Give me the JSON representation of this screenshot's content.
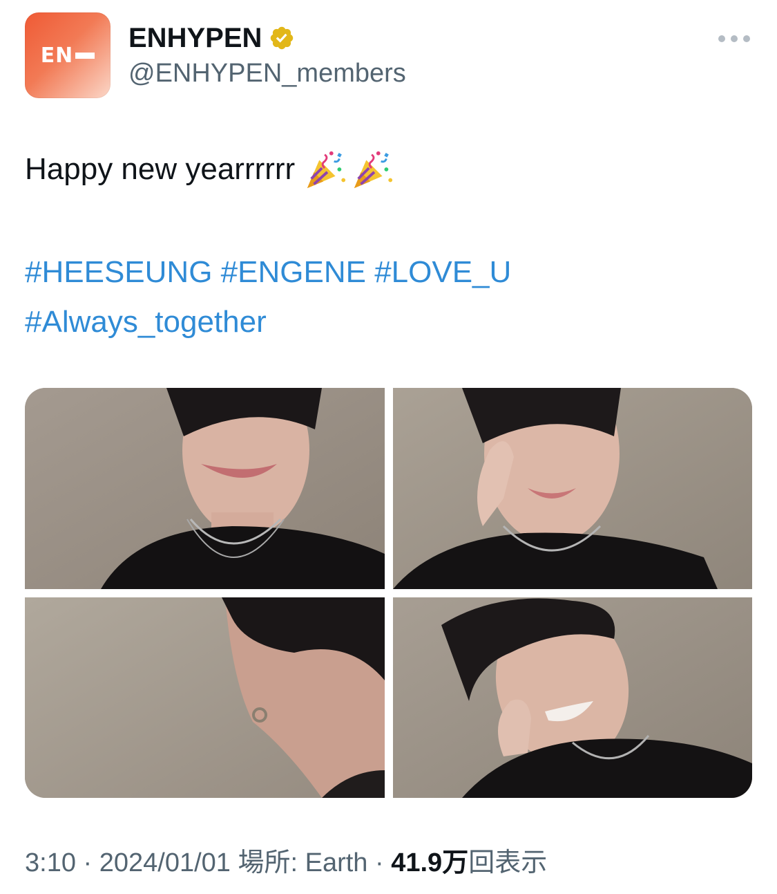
{
  "account": {
    "display_name": "ENHYPEN",
    "handle": "@ENHYPEN_members",
    "avatar_text": "EN",
    "verified_icon": "gold-verified-badge-icon"
  },
  "more_menu_icon": "more-options-icon",
  "tweet": {
    "text": "Happy new yearrrrrr",
    "emojis": [
      "party-popper-icon",
      "party-popper-icon"
    ],
    "hashtags": [
      "#HEESEUNG",
      "#ENGENE",
      "#LOVE_U",
      "#Always_together"
    ]
  },
  "media": [
    {
      "name": "photo-1",
      "description_icon": "selfie-photo"
    },
    {
      "name": "photo-2",
      "description_icon": "selfie-photo"
    },
    {
      "name": "photo-3",
      "description_icon": "selfie-photo"
    },
    {
      "name": "photo-4",
      "description_icon": "selfie-photo"
    }
  ],
  "footer": {
    "time": "3:10",
    "separator": "·",
    "date": "2024/01/01",
    "location": "場所: Earth",
    "views_count": "41.9万",
    "views_label": "回表示"
  },
  "colors": {
    "link": "#2f8bd6",
    "secondary_text": "#536471",
    "brand_gradient_start": "#ef5a35",
    "verified_gold": "#e2b719"
  }
}
